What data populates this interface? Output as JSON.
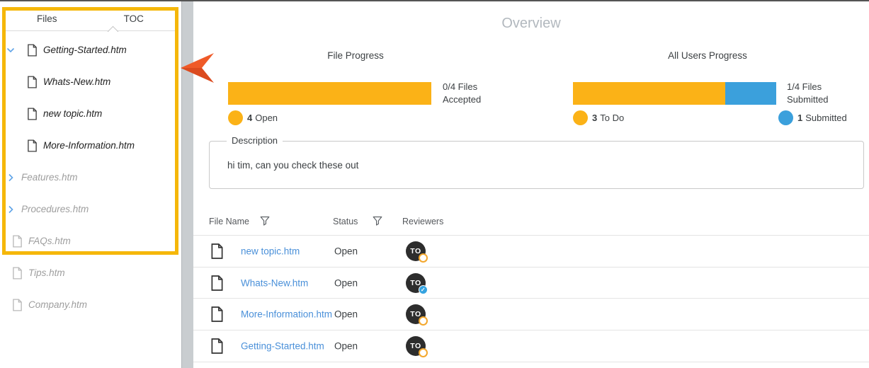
{
  "annotations": {
    "highlight_color": "#F5B70A",
    "arrow_color": "#EE5726",
    "arrow_points": "left-toward-sidebar"
  },
  "sidebar": {
    "tabs": [
      {
        "label": "Files"
      },
      {
        "label": "TOC"
      }
    ],
    "active_tab": "TOC",
    "tree": [
      {
        "label": "Getting-Started.htm",
        "chevron": "down",
        "icon": "file",
        "muted": false
      },
      {
        "label": "Whats-New.htm",
        "chevron": "",
        "icon": "file",
        "muted": false
      },
      {
        "label": "new topic.htm",
        "chevron": "",
        "icon": "file",
        "muted": false
      },
      {
        "label": "More-Information.htm",
        "chevron": "",
        "icon": "file",
        "muted": false
      },
      {
        "label": "Features.htm",
        "chevron": "right",
        "icon": "",
        "muted": true
      },
      {
        "label": "Procedures.htm",
        "chevron": "right",
        "icon": "",
        "muted": true
      },
      {
        "label": "FAQs.htm",
        "chevron": "",
        "icon": "file",
        "muted": true
      },
      {
        "label": "Tips.htm",
        "chevron": "",
        "icon": "file",
        "muted": true
      },
      {
        "label": "Company.htm",
        "chevron": "",
        "icon": "file",
        "muted": true
      }
    ]
  },
  "main": {
    "title": "Overview",
    "file_progress": {
      "title": "File Progress",
      "caption_lines": [
        "0/4 Files",
        "Accepted"
      ],
      "segments": [
        {
          "name": "Open",
          "fraction": 1,
          "color": "#FBB217"
        }
      ],
      "legend": [
        {
          "count": "4",
          "label": "Open",
          "color": "#FBB217"
        }
      ]
    },
    "users_progress": {
      "title": "All Users Progress",
      "caption_lines": [
        "1/4 Files",
        "Submitted"
      ],
      "segments": [
        {
          "name": "To Do",
          "fraction": 0.75,
          "color": "#FBB217"
        },
        {
          "name": "Submitted",
          "fraction": 0.25,
          "color": "#3BA0DC"
        }
      ],
      "legend": [
        {
          "count": "3",
          "label": "To Do",
          "color": "#FBB217"
        },
        {
          "count": "1",
          "label": "Submitted",
          "color": "#3BA0DC"
        }
      ]
    },
    "description": {
      "label": "Description",
      "value": "hi tim, can you check these out"
    },
    "table": {
      "headers": [
        {
          "label": "File Name",
          "filter": true
        },
        {
          "label": "Status",
          "filter": true
        },
        {
          "label": "Reviewers",
          "filter": false
        }
      ],
      "rows": [
        {
          "file_name": "new topic.htm",
          "status": "Open",
          "reviewer": {
            "initials": "TO",
            "badge": "todo"
          }
        },
        {
          "file_name": "Whats-New.htm",
          "status": "Open",
          "reviewer": {
            "initials": "TO",
            "badge": "submitted"
          }
        },
        {
          "file_name": "More-Information.htm",
          "status": "Open",
          "reviewer": {
            "initials": "TO",
            "badge": "todo"
          }
        },
        {
          "file_name": "Getting-Started.htm",
          "status": "Open",
          "reviewer": {
            "initials": "TO",
            "badge": "todo"
          }
        }
      ]
    }
  }
}
